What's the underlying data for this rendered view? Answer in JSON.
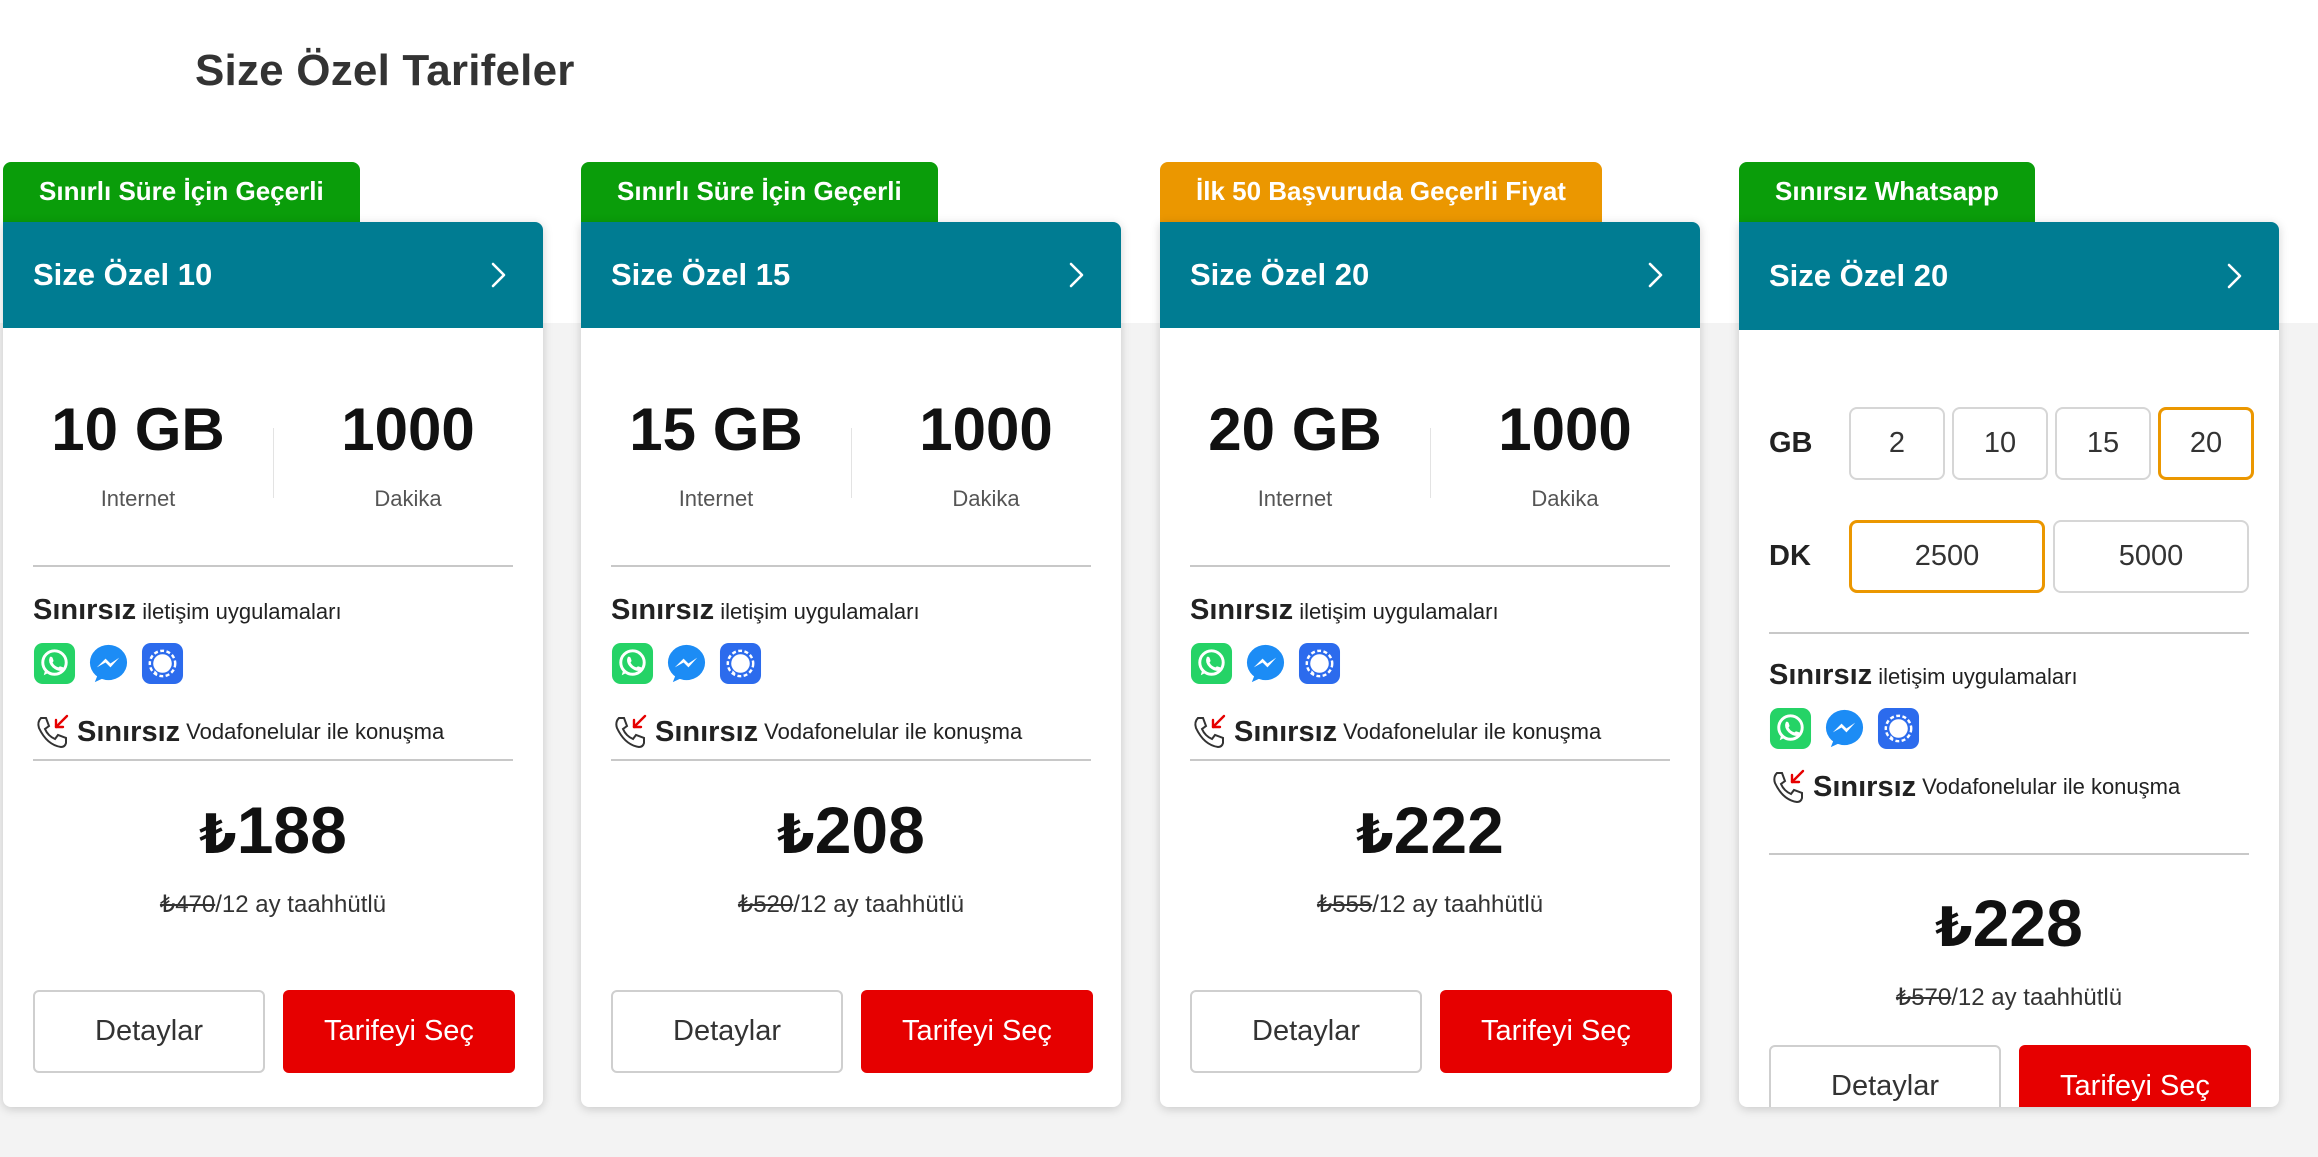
{
  "page": {
    "title": "Size Özel Tarifeler"
  },
  "colors": {
    "header_teal": "#007c92",
    "badge_green": "#0a9d0a",
    "badge_orange": "#eb9700",
    "select_red": "#e60000",
    "option_selected": "#eb9700"
  },
  "labels": {
    "internet": "Internet",
    "minutes": "Dakika",
    "unlimited": "Sınırsız",
    "apps_suffix": "iletişim uygulamaları",
    "vodafone_suffix": "Vodafonelular ile konuşma",
    "commit_suffix": "/12 ay taahhütlü",
    "currency": "₺",
    "details_button": "Detaylar",
    "select_button": "Tarifeyi Seç",
    "gb_label": "GB",
    "dk_label": "DK"
  },
  "icons": {
    "header_arrow": "chevron-right-icon",
    "apps": [
      "whatsapp-icon",
      "messenger-icon",
      "signal-icon"
    ],
    "vodafone_call": "incoming-call-icon"
  },
  "cards": [
    {
      "badge": "Sınırlı Süre İçin Geçerli",
      "badge_color": "green",
      "title": "Size Özel 10",
      "data": "10 GB",
      "minutes": "1000",
      "price": "188",
      "old_price": "₺470"
    },
    {
      "badge": "Sınırlı Süre İçin Geçerli",
      "badge_color": "green",
      "title": "Size Özel 15",
      "data": "15 GB",
      "minutes": "1000",
      "price": "208",
      "old_price": "₺520"
    },
    {
      "badge": "İlk 50 Başvuruda Geçerli Fiyat",
      "badge_color": "orange",
      "title": "Size Özel 20",
      "data": "20 GB",
      "minutes": "1000",
      "price": "222",
      "old_price": "₺555"
    },
    {
      "badge": "Sınırsız Whatsapp",
      "badge_color": "green",
      "title": "Size Özel 20",
      "price": "228",
      "old_price": "₺570",
      "gb_options": [
        "2",
        "10",
        "15",
        "20"
      ],
      "gb_selected": "20",
      "dk_options": [
        "2500",
        "5000"
      ],
      "dk_selected": "2500"
    }
  ]
}
